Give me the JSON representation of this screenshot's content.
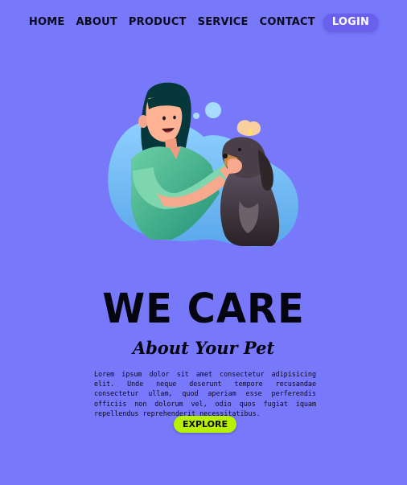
{
  "nav": {
    "items": [
      "HOME",
      "ABOUT",
      "PRODUCT",
      "SERVICE",
      "CONTACT"
    ],
    "login_label": "LOGIN"
  },
  "hero": {
    "title": "WE CARE",
    "subtitle": "About Your Pet",
    "body": "Lorem ipsum dolor sit amet consectetur adipisicing elit. Unde neque deserunt tempore recusandae consectetur ullam, quod aperiam esse perferendis officiis non dolorum vel, odio quos fugiat iquam repellendus reprehenderit necessitatibus.",
    "button_label": "EXPLORE",
    "illustration": "woman-grooming-dog-illustration"
  },
  "colors": {
    "background": "#7878fb",
    "login_button": "#6a60f0",
    "explore_button": "#b7f000"
  }
}
